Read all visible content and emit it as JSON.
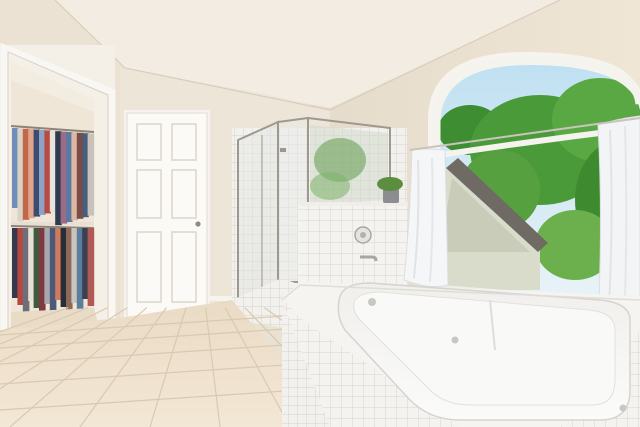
{
  "scene": {
    "description_free": true,
    "palette": {
      "wall": "#ece4d6",
      "wall_shadow": "#d9ceba",
      "ceiling": "#f1ebe1",
      "floor_tile": "#efe2cf",
      "grout": "#d8c8b2",
      "door": "#f7f5f1",
      "tile_white": "#f4f2ee",
      "sky": "#cfe6f3",
      "foliage": "#4f9a3a",
      "tub_water": "#f6f6f4",
      "curtain": "#f3f4f6",
      "glass_frame": "#a9a49a"
    },
    "clothes_colors": [
      "#6f8fb8",
      "#d9d2c6",
      "#c0684a",
      "#e0a58c",
      "#3d4c6e",
      "#8aa3c7",
      "#b74a43",
      "#e7e2da",
      "#2f3b52",
      "#9c6c86",
      "#5b7aa3",
      "#dcb8a3",
      "#7b4b45",
      "#4a5d79",
      "#c8c2ba"
    ],
    "lower_clothes_colors": [
      "#33384a",
      "#b8483f",
      "#6d6e7a",
      "#e6e0d6",
      "#3e5a3f",
      "#7e3a40",
      "#a9a8ae",
      "#4b5a78",
      "#d07b5e",
      "#2a2d36",
      "#8d6a58",
      "#c9c4bf",
      "#5c7e9c",
      "#3a3f52",
      "#b05a55"
    ]
  }
}
